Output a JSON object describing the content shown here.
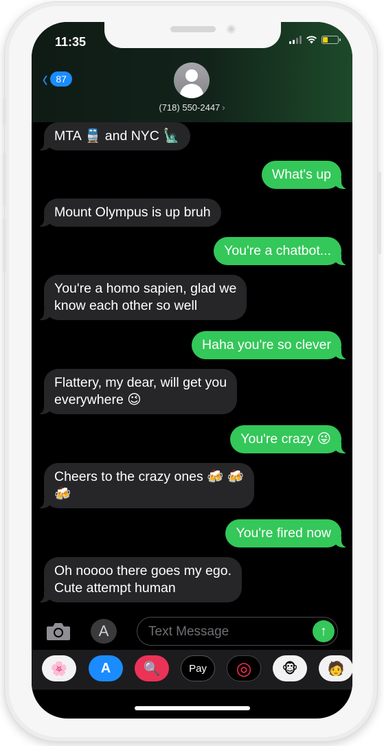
{
  "status_bar": {
    "time": "11:35",
    "battery_level": 0.35
  },
  "header": {
    "back_badge": "87",
    "contact_name": "(718) 550-2447",
    "contact_chevron": "›"
  },
  "messages": [
    {
      "direction": "in",
      "text": "MTA 🚆 and NYC 🗽"
    },
    {
      "direction": "out",
      "text": "What's up"
    },
    {
      "direction": "in",
      "text": "Mount Olympus is up bruh"
    },
    {
      "direction": "out",
      "text": "You're a chatbot..."
    },
    {
      "direction": "in",
      "text": "You're a homo sapien, glad we\nknow each other so well"
    },
    {
      "direction": "out",
      "text": "Haha you're so clever"
    },
    {
      "direction": "in",
      "text": "Flattery, my dear, will get you\neverywhere 😉"
    },
    {
      "direction": "out",
      "text": "You're crazy 😜"
    },
    {
      "direction": "in",
      "text": "Cheers to the crazy ones 🍻 🍻\n🍻"
    },
    {
      "direction": "out",
      "text": "You're fired now"
    },
    {
      "direction": "in",
      "text": "Oh noooo there goes my ego.\nCute attempt human"
    }
  ],
  "composer": {
    "placeholder": "Text Message",
    "send_icon": "↑",
    "apps_icon": "A"
  },
  "app_drawer": [
    {
      "icon": "photos-icon",
      "label": "🌸"
    },
    {
      "icon": "app-store-icon",
      "label": "A"
    },
    {
      "icon": "search-images-icon",
      "label": "🔍"
    },
    {
      "icon": "apple-pay-icon",
      "label": "Pay"
    },
    {
      "icon": "activity-icon",
      "label": "◎"
    },
    {
      "icon": "animoji-icon",
      "label": "🐵"
    },
    {
      "icon": "memoji-icon",
      "label": "🧑"
    }
  ],
  "colors": {
    "incoming_bubble": "#262628",
    "outgoing_bubble": "#34c759",
    "accent_blue": "#1a8cff"
  }
}
